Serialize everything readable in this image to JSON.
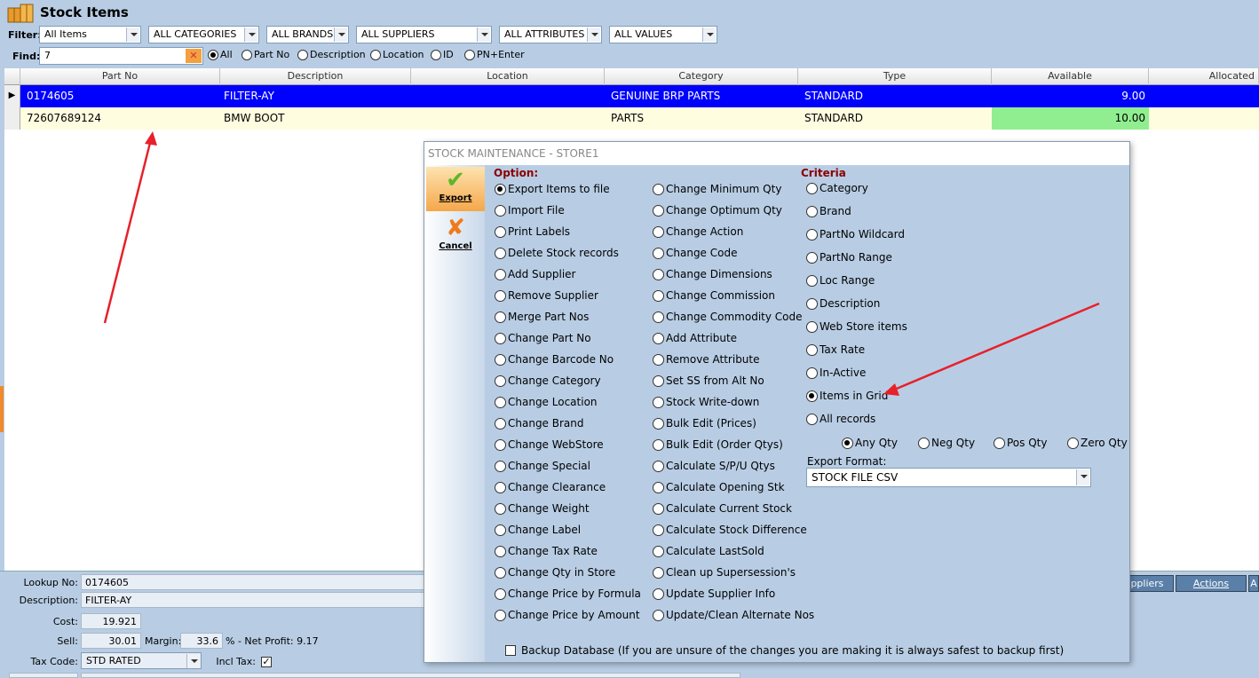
{
  "window": {
    "title": "Stock Items"
  },
  "filter": {
    "label": "Filter:",
    "items": "All Items",
    "categories": "ALL CATEGORIES",
    "brands": "ALL BRANDS",
    "suppliers": "ALL SUPPLIERS",
    "attributes": "ALL ATTRIBUTES",
    "values": "ALL VALUES"
  },
  "find": {
    "label": "Find:",
    "value": "7",
    "options": [
      "All",
      "Part No",
      "Description",
      "Location",
      "ID",
      "PN+Enter"
    ],
    "selected": "All"
  },
  "grid": {
    "columns": [
      "Part No",
      "Description",
      "Location",
      "Category",
      "Type",
      "Available",
      "Allocated"
    ],
    "rows": [
      {
        "part_no": "0174605",
        "description": "FILTER-AY",
        "location": "",
        "category": "GENUINE BRP PARTS",
        "type": "STANDARD",
        "available": "9.00",
        "allocated": ""
      },
      {
        "part_no": "72607689124",
        "description": "BMW BOOT",
        "location": "",
        "category": "PARTS",
        "type": "STANDARD",
        "available": "10.00",
        "allocated": ""
      }
    ],
    "available_highlight": "#90ee90",
    "selected_row_color": "#0000ff"
  },
  "detail": {
    "lookup_label": "Lookup No:",
    "lookup_value": "0174605",
    "description_label": "Description:",
    "description_value": "FILTER-AY",
    "cost_label": "Cost:",
    "cost_value": "19.921",
    "sell_label": "Sell:",
    "sell_value": "30.01",
    "margin_label": "Margin:",
    "margin_value": "33.6",
    "net_profit": "% - Net Profit: 9.17",
    "taxcode_label": "Tax Code:",
    "taxcode_value": "STD RATED",
    "incltax_label": "Incl Tax:",
    "tabs": [
      "ppliers",
      "Actions",
      "A"
    ]
  },
  "modal": {
    "title": "STOCK MAINTENANCE - STORE1",
    "export_label": "Export",
    "cancel_label": "Cancel",
    "option_header": "Option:",
    "criteria_header": "Criteria",
    "options_col1": [
      "Export Items to file",
      "Import File",
      "Print Labels",
      "Delete Stock records",
      "Add Supplier",
      "Remove Supplier",
      "Merge Part Nos",
      "Change Part No",
      "Change Barcode No",
      "Change Category",
      "Change Location",
      "Change Brand",
      "Change WebStore",
      "Change Special",
      "Change Clearance",
      "Change Weight",
      "Change Label",
      "Change Tax Rate",
      "Change Qty in Store",
      "Change Price by Formula",
      "Change Price by Amount"
    ],
    "options_col2": [
      "Change Minimum Qty",
      "Change Optimum Qty",
      "Change Action",
      "Change Code",
      "Change Dimensions",
      "Change Commission",
      "Change Commodity Code",
      "Add Attribute",
      "Remove Attribute",
      "Set SS from Alt No",
      "Stock Write-down",
      "Bulk Edit (Prices)",
      "Bulk Edit (Order Qtys)",
      "Calculate S/P/U Qtys",
      "Calculate Opening Stk",
      "Calculate Current Stock",
      "Calculate Stock Difference",
      "Calculate LastSold",
      "Clean up Supersession's",
      "Update Supplier Info",
      "Update/Clean Alternate Nos"
    ],
    "selected_option": "Export Items to file",
    "criteria": [
      "Category",
      "Brand",
      "PartNo Wildcard",
      "PartNo Range",
      "Loc Range",
      "Description",
      "Web Store items",
      "Tax Rate",
      "In-Active",
      "Items in Grid",
      "All records"
    ],
    "selected_criteria": "Items in Grid",
    "qty_options": [
      "Any Qty",
      "Neg Qty",
      "Pos Qty",
      "Zero Qty"
    ],
    "selected_qty": "Any Qty",
    "export_format_label": "Export Format:",
    "export_format_value": "STOCK FILE CSV",
    "backup_label": "Backup Database (If you are unsure of the changes you are making it is always safest to backup first)"
  },
  "annotation_color": "#e8202a"
}
